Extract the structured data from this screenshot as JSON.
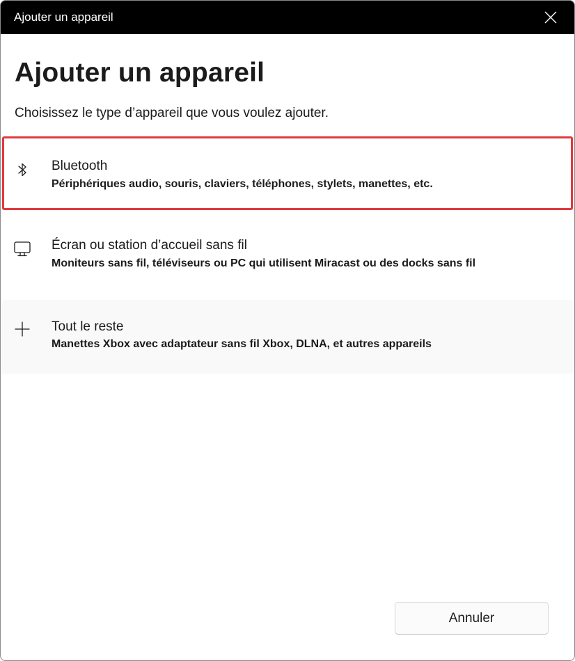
{
  "window": {
    "title": "Ajouter un appareil"
  },
  "dialog": {
    "heading": "Ajouter un appareil",
    "subtitle": "Choisissez le type d’appareil que vous voulez ajouter."
  },
  "options": [
    {
      "icon": "bluetooth-icon",
      "title": "Bluetooth",
      "description": "Périphériques audio, souris, claviers, téléphones, stylets, manettes, etc.",
      "highlighted": true
    },
    {
      "icon": "monitor-icon",
      "title": "Écran ou station d’accueil sans fil",
      "description": "Moniteurs sans fil, téléviseurs ou PC qui utilisent Miracast ou des docks sans fil",
      "highlighted": false
    },
    {
      "icon": "plus-icon",
      "title": "Tout le reste",
      "description": "Manettes Xbox avec adaptateur sans fil Xbox, DLNA, et autres appareils",
      "highlighted": false
    }
  ],
  "footer": {
    "cancel_label": "Annuler"
  },
  "colors": {
    "titlebar": "#000000",
    "highlight_border": "#e0393e",
    "text": "#1b1b1b"
  }
}
